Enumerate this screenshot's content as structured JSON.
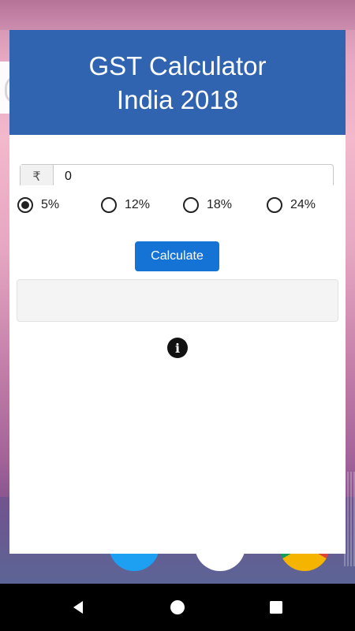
{
  "app": {
    "title_line1": "GST Calculator",
    "title_line2": "India 2018"
  },
  "input": {
    "currency_symbol": "₹",
    "value": "0"
  },
  "rates": [
    {
      "label": "5%",
      "selected": true
    },
    {
      "label": "12%",
      "selected": false
    },
    {
      "label": "18%",
      "selected": false
    },
    {
      "label": "24%",
      "selected": false
    }
  ],
  "actions": {
    "calculate_label": "Calculate"
  },
  "result": {
    "text": ""
  },
  "info": {
    "icon_name": "info-icon",
    "glyph": "i"
  },
  "colors": {
    "header_bg": "#3063b0",
    "button_bg": "#1673d6"
  },
  "navigation": {
    "back_icon": "back-icon",
    "home_icon": "home-icon",
    "recents_icon": "recents-icon"
  }
}
